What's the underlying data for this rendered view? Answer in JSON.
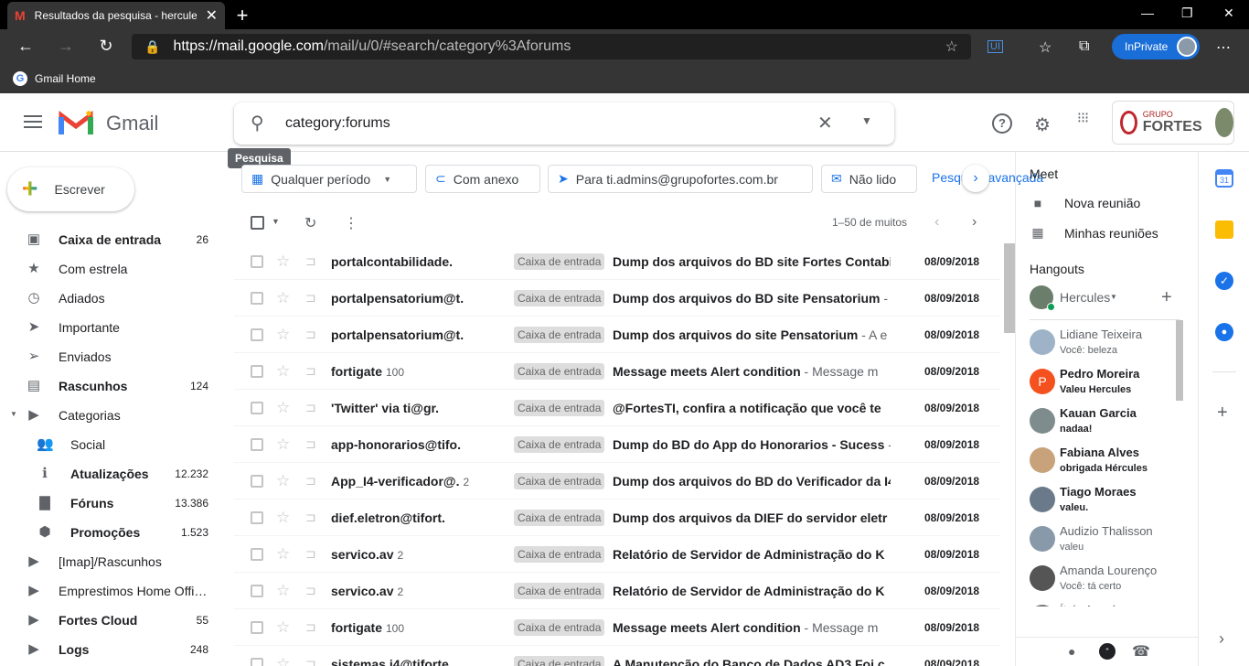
{
  "browser": {
    "tab_title": "Resultados da pesquisa - hercule",
    "tab_close": "✕",
    "new_tab": "+",
    "url_prefix": "https://",
    "url_host": "mail.google.com",
    "url_path": "/mail/u/0/#search/category%3Aforums",
    "in_private": "InPrivate",
    "favorite": "Gmail Home"
  },
  "header": {
    "app_name": "Gmail",
    "search_query": "category:forums",
    "tooltip": "Pesquisa",
    "brand_grupo": "GRUPO",
    "brand_name": "FORTES"
  },
  "compose": {
    "label": "Escrever"
  },
  "nav": [
    {
      "label": "Caixa de entrada",
      "count": "26",
      "bold": true,
      "icon": "inbox-icon",
      "glyph": "▣"
    },
    {
      "label": "Com estrela",
      "count": "",
      "bold": false,
      "icon": "star-icon",
      "glyph": "★"
    },
    {
      "label": "Adiados",
      "count": "",
      "bold": false,
      "icon": "clock-icon",
      "glyph": "◷"
    },
    {
      "label": "Importante",
      "count": "",
      "bold": false,
      "icon": "important-icon",
      "glyph": "➤"
    },
    {
      "label": "Enviados",
      "count": "",
      "bold": false,
      "icon": "send-icon",
      "glyph": "➢"
    },
    {
      "label": "Rascunhos",
      "count": "124",
      "bold": true,
      "icon": "draft-icon",
      "glyph": "▤"
    },
    {
      "label": "Categorias",
      "count": "",
      "bold": false,
      "icon": "label-icon",
      "glyph": "▶"
    }
  ],
  "categories": [
    {
      "label": "Social",
      "count": "",
      "bold": false,
      "icon": "people-icon",
      "glyph": "👥"
    },
    {
      "label": "Atualizações",
      "count": "12.232",
      "bold": true,
      "icon": "info-icon",
      "glyph": "ℹ"
    },
    {
      "label": "Fóruns",
      "count": "13.386",
      "bold": true,
      "icon": "forum-icon",
      "glyph": "▇"
    },
    {
      "label": "Promoções",
      "count": "1.523",
      "bold": true,
      "icon": "tag-icon",
      "glyph": "⬢"
    }
  ],
  "labels": [
    {
      "label": "[Imap]/Rascunhos",
      "count": "",
      "bold": false
    },
    {
      "label": "Emprestimos Home Offi…",
      "count": "",
      "bold": false
    },
    {
      "label": "Fortes Cloud",
      "count": "55",
      "bold": true
    },
    {
      "label": "Logs",
      "count": "248",
      "bold": true
    }
  ],
  "chips": [
    {
      "label": "Qualquer período",
      "icon": "calendar-icon"
    },
    {
      "label": "Com anexo",
      "icon": "attachment-icon"
    },
    {
      "label": "Para ti.admins@grupofortes.com.br",
      "icon": "send-icon"
    },
    {
      "label": "Não lido",
      "icon": "mail-icon"
    }
  ],
  "chips_more": "Pesquisa avançada",
  "pager": "1–50 de muitos",
  "emails": [
    {
      "sender": "portalcontabilidade.",
      "count": "",
      "label": "Caixa de entrada",
      "subject": "Dump dos arquivos do BD site Fortes Contabi",
      "snippet": "",
      "date": "08/09/2018"
    },
    {
      "sender": "portalpensatorium@t.",
      "count": "",
      "label": "Caixa de entrada",
      "subject": "Dump dos arquivos do BD site Pensatorium",
      "snippet": " - A",
      "date": "08/09/2018"
    },
    {
      "sender": "portalpensatorium@t.",
      "count": "",
      "label": "Caixa de entrada",
      "subject": "Dump dos arquivos do site Pensatorium",
      "snippet": " - A e",
      "date": "08/09/2018"
    },
    {
      "sender": "fortigate",
      "count": "100",
      "label": "Caixa de entrada",
      "subject": "Message meets Alert condition",
      "snippet": " - Message m",
      "date": "08/09/2018"
    },
    {
      "sender": "'Twitter' via ti@gr.",
      "count": "",
      "label": "Caixa de entrada",
      "subject": "@FortesTI, confira a notificação que você te",
      "snippet": "",
      "date": "08/09/2018"
    },
    {
      "sender": "app-honorarios@tifo.",
      "count": "",
      "label": "Caixa de entrada",
      "subject": "Dump do BD do App do Honorarios - Sucess",
      "snippet": " - A",
      "date": "08/09/2018"
    },
    {
      "sender": "App_I4-verificador@.",
      "count": "2",
      "label": "Caixa de entrada",
      "subject": "Dump dos arquivos do BD do Verificador da I4",
      "snippet": " -",
      "date": "08/09/2018"
    },
    {
      "sender": "dief.eletron@tifort.",
      "count": "",
      "label": "Caixa de entrada",
      "subject": "Dump dos arquivos da DIEF do servidor eletr",
      "snippet": "",
      "date": "08/09/2018"
    },
    {
      "sender": "servico.av",
      "count": "2",
      "label": "Caixa de entrada",
      "subject": "Relatório de Servidor de Administração do K",
      "snippet": "",
      "date": "08/09/2018"
    },
    {
      "sender": "servico.av",
      "count": "2",
      "label": "Caixa de entrada",
      "subject": "Relatório de Servidor de Administração do K",
      "snippet": "",
      "date": "08/09/2018"
    },
    {
      "sender": "fortigate",
      "count": "100",
      "label": "Caixa de entrada",
      "subject": "Message meets Alert condition",
      "snippet": " - Message m",
      "date": "08/09/2018"
    },
    {
      "sender": "sistemas.i4@tiforte.",
      "count": "",
      "label": "Caixa de entrada",
      "subject": "A Manutenção do Banco de Dados AD3 Foi c",
      "snippet": "",
      "date": "08/09/2018"
    }
  ],
  "meet": {
    "title": "Meet",
    "items": [
      {
        "label": "Nova reunião",
        "icon": "video-icon"
      },
      {
        "label": "Minhas reuniões",
        "icon": "calendar-icon"
      }
    ]
  },
  "hangouts": {
    "title": "Hangouts",
    "user": "Hercules",
    "contacts": [
      {
        "name": "Lidiane Teixeira",
        "status": "Você: beleza",
        "unread": false,
        "color": "#9fb3c8"
      },
      {
        "name": "Pedro Moreira",
        "status": "Valeu Hercules",
        "unread": true,
        "color": "#f4511e",
        "initial": "P"
      },
      {
        "name": "Kauan Garcia",
        "status": "nadaa!",
        "unread": true,
        "color": "#7f8c8d"
      },
      {
        "name": "Fabiana Alves",
        "status": "obrigada Hércules",
        "unread": true,
        "color": "#c8a27a"
      },
      {
        "name": "Tiago Moraes",
        "status": "valeu.",
        "unread": true,
        "color": "#6b7a8a"
      },
      {
        "name": "Audizio Thalisson",
        "status": "valeu",
        "unread": false,
        "color": "#8899aa"
      },
      {
        "name": "Amanda Lourenço",
        "status": "Você: tá certo",
        "unread": false,
        "color": "#555"
      },
      {
        "name": "Ítalo Angelo",
        "status": "",
        "unread": false,
        "color": "#777"
      }
    ]
  },
  "colors": {
    "accent": "#1a73e8",
    "browser_dark": "#353535",
    "inprivate": "#1a6ed8"
  }
}
